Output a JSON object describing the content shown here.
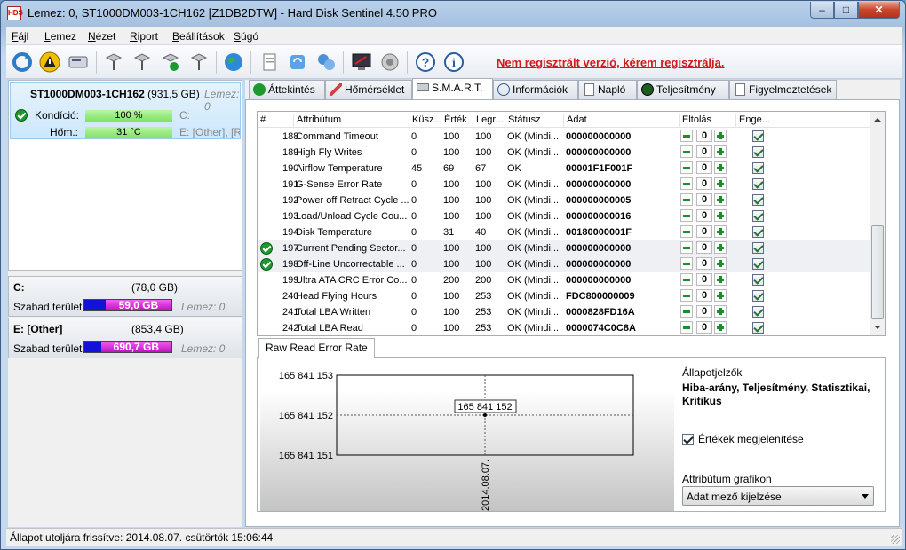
{
  "window": {
    "title": "Lemez: 0, ST1000DM003-1CH162 [Z1DB2DTW]  -  Hard Disk Sentinel 4.50 PRO",
    "icon_label": "HDS"
  },
  "menu": [
    "Fájl",
    "Lemez",
    "Nézet",
    "Riport",
    "Beállítások",
    "Súgó"
  ],
  "registration_notice": "Nem regisztrált verzió, kérem regisztrálja.",
  "disk": {
    "name": "ST1000DM003-1CH162",
    "size": "(931,5 GB)",
    "volume_ref": "Lemez: 0",
    "condition_label": "Kondíció:",
    "condition_value": "100 %",
    "condition_pct": 100,
    "condition_drive": "C:",
    "temp_label": "Hőm.:",
    "temp_value": "31 °C",
    "temp_drive": "E: [Other],  [R"
  },
  "volumes": [
    {
      "title": "C:",
      "size": "(78,0 GB)",
      "free_label": "Szabad terület",
      "free": "59,0 GB",
      "free_fraction": 0.756,
      "lemez": "Lemez: 0"
    },
    {
      "title": "E: [Other]",
      "size": "(853,4 GB)",
      "free_label": "Szabad terület",
      "free": "690,7 GB",
      "free_fraction": 0.809,
      "lemez": "Lemez: 0"
    }
  ],
  "tabs": [
    "Áttekintés",
    "Hőmérséklet",
    "S.M.A.R.T.",
    "Információk",
    "Napló",
    "Teljesítmény",
    "Figyelmeztetések"
  ],
  "smart": {
    "headers": [
      "#",
      "Attribútum",
      "Küsz...",
      "Érték",
      "Legr...",
      "Státusz",
      "Adat",
      "Eltolás",
      "Enge..."
    ],
    "rows": [
      {
        "id": "188",
        "attr": "Command Timeout",
        "thr": "0",
        "val": "100",
        "worst": "100",
        "status": "OK (Mindi...",
        "data": "000000000000",
        "offset": "0",
        "ok_icon": false,
        "hl": false
      },
      {
        "id": "189",
        "attr": "High Fly Writes",
        "thr": "0",
        "val": "100",
        "worst": "100",
        "status": "OK (Mindi...",
        "data": "000000000000",
        "offset": "0",
        "ok_icon": false,
        "hl": false
      },
      {
        "id": "190",
        "attr": "Airflow Temperature",
        "thr": "45",
        "val": "69",
        "worst": "67",
        "status": "OK",
        "data": "00001F1F001F",
        "offset": "0",
        "ok_icon": false,
        "hl": false
      },
      {
        "id": "191",
        "attr": "G-Sense Error Rate",
        "thr": "0",
        "val": "100",
        "worst": "100",
        "status": "OK (Mindi...",
        "data": "000000000000",
        "offset": "0",
        "ok_icon": false,
        "hl": false
      },
      {
        "id": "192",
        "attr": "Power off Retract Cycle ...",
        "thr": "0",
        "val": "100",
        "worst": "100",
        "status": "OK (Mindi...",
        "data": "000000000005",
        "offset": "0",
        "ok_icon": false,
        "hl": false
      },
      {
        "id": "193",
        "attr": "Load/Unload Cycle Cou...",
        "thr": "0",
        "val": "100",
        "worst": "100",
        "status": "OK (Mindi...",
        "data": "000000000016",
        "offset": "0",
        "ok_icon": false,
        "hl": false
      },
      {
        "id": "194",
        "attr": "Disk Temperature",
        "thr": "0",
        "val": "31",
        "worst": "40",
        "status": "OK (Mindi...",
        "data": "00180000001F",
        "offset": "0",
        "ok_icon": false,
        "hl": false
      },
      {
        "id": "197",
        "attr": "Current Pending Sector...",
        "thr": "0",
        "val": "100",
        "worst": "100",
        "status": "OK (Mindi...",
        "data": "000000000000",
        "offset": "0",
        "ok_icon": true,
        "hl": true
      },
      {
        "id": "198",
        "attr": "Off-Line Uncorrectable ...",
        "thr": "0",
        "val": "100",
        "worst": "100",
        "status": "OK (Mindi...",
        "data": "000000000000",
        "offset": "0",
        "ok_icon": true,
        "hl": true
      },
      {
        "id": "199",
        "attr": "Ultra ATA CRC Error Co...",
        "thr": "0",
        "val": "200",
        "worst": "200",
        "status": "OK (Mindi...",
        "data": "000000000000",
        "offset": "0",
        "ok_icon": false,
        "hl": false
      },
      {
        "id": "240",
        "attr": "Head Flying Hours",
        "thr": "0",
        "val": "100",
        "worst": "253",
        "status": "OK (Mindi...",
        "data": "FDC800000009",
        "offset": "0",
        "ok_icon": false,
        "hl": false
      },
      {
        "id": "241",
        "attr": "Total LBA Written",
        "thr": "0",
        "val": "100",
        "worst": "253",
        "status": "OK (Mindi...",
        "data": "0000828FD16A",
        "offset": "0",
        "ok_icon": false,
        "hl": false
      },
      {
        "id": "242",
        "attr": "Total LBA Read",
        "thr": "0",
        "val": "100",
        "worst": "253",
        "status": "OK (Mindi...",
        "data": "0000074C0C8A",
        "offset": "0",
        "ok_icon": false,
        "hl": false
      }
    ]
  },
  "graph": {
    "tab_label": "Raw Read Error Rate",
    "y_ticks": [
      "165 841 153",
      "165 841 152",
      "165 841 151"
    ],
    "point_label": "165 841 152",
    "x_label": "2014.08.07."
  },
  "side": {
    "status_indicators_label": "Állapotjelzők",
    "status_indicators": "Hiba-arány, Teljesítmény, Statisztikai, Kritikus",
    "show_values_label": "Értékek megjelenítése",
    "show_values_checked": true,
    "attr_graph_label": "Attribútum grafikon",
    "attr_graph_value": "Adat mező kijelzése"
  },
  "status_bar": "Állapot utoljára frissítve: 2014.08.07. csütörtök 15:06:44"
}
